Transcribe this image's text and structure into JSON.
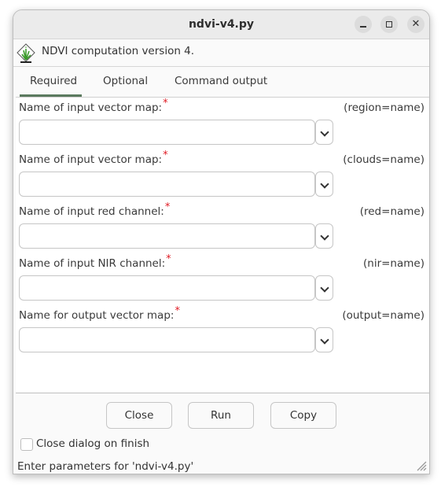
{
  "window": {
    "title": "ndvi-v4.py",
    "controls": {
      "minimize": "minimize",
      "maximize": "maximize",
      "close": "close"
    }
  },
  "header": {
    "icon": "grass-gis-icon",
    "description": "NDVI computation version 4."
  },
  "tabs": [
    {
      "label": "Required",
      "active": true
    },
    {
      "label": "Optional",
      "active": false
    },
    {
      "label": "Command output",
      "active": false
    }
  ],
  "fields": [
    {
      "label": "Name of input vector map:",
      "required_mark": "*",
      "param": "(region=name)",
      "value": ""
    },
    {
      "label": "Name of input vector map:",
      "required_mark": "*",
      "param": "(clouds=name)",
      "value": ""
    },
    {
      "label": "Name of input red channel:",
      "required_mark": "*",
      "param": "(red=name)",
      "value": ""
    },
    {
      "label": "Name of input NIR channel:",
      "required_mark": "*",
      "param": "(nir=name)",
      "value": ""
    },
    {
      "label": "Name for output vector map:",
      "required_mark": "*",
      "param": "(output=name)",
      "value": ""
    }
  ],
  "buttons": {
    "close": "Close",
    "run": "Run",
    "copy": "Copy"
  },
  "close_on_finish": {
    "label": "Close dialog on finish",
    "checked": false
  },
  "status_bar": {
    "text": "Enter parameters for 'ndvi-v4.py'"
  },
  "colors": {
    "accent_tab": "#5b7a5e",
    "required": "#e01b24"
  }
}
